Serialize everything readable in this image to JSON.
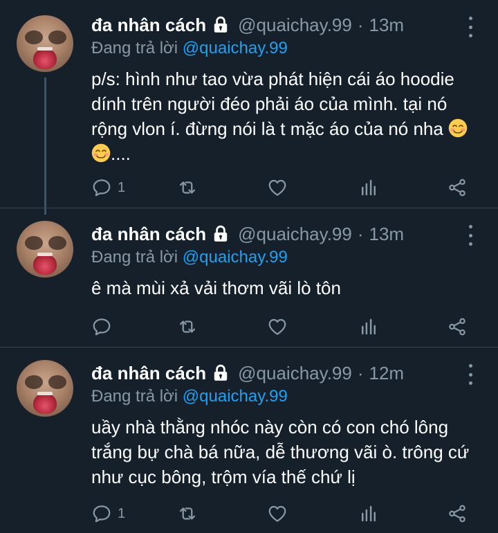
{
  "colors": {
    "background": "#15202b",
    "secondary_text": "#8899a6",
    "accent": "#1da1f2",
    "divider": "#38444d"
  },
  "tweets": [
    {
      "display_name": "đa nhân cách",
      "handle": "@quaichay.99",
      "separator": "·",
      "time": "13m",
      "reply_prefix": "Đang trả lời",
      "reply_to": "@quaichay.99",
      "text": "p/s: hình như tao vừa phát hiện cái áo hoodie dính trên người đéo phải áo của mình. tại nó rộng vlon í. đừng nói là t mặc áo của nó nha",
      "text_suffix": "....",
      "emojis": [
        "smiling-face-with-smiling-eyes",
        "smiling-face-with-smiling-eyes"
      ],
      "reply_count": "1"
    },
    {
      "display_name": "đa nhân cách",
      "handle": "@quaichay.99",
      "separator": "·",
      "time": "13m",
      "reply_prefix": "Đang trả lời",
      "reply_to": "@quaichay.99",
      "text": "ê mà mùi xả vải thơm vãi lò tôn",
      "reply_count": ""
    },
    {
      "display_name": "đa nhân cách",
      "handle": "@quaichay.99",
      "separator": "·",
      "time": "12m",
      "reply_prefix": "Đang trả lời",
      "reply_to": "@quaichay.99",
      "text": "uầy nhà thằng nhóc này còn có con chó lông trắng bự chà bá nữa, dễ thương vãi ò. trông cứ như cục bông, trộm vía thế chứ lị",
      "reply_count": "1"
    }
  ],
  "icons": {
    "verified_lock": "lock-icon",
    "more": "more-vertical-icon",
    "reply": "reply-icon",
    "retweet": "retweet-icon",
    "like": "heart-icon",
    "analytics": "analytics-icon",
    "share": "share-icon"
  }
}
